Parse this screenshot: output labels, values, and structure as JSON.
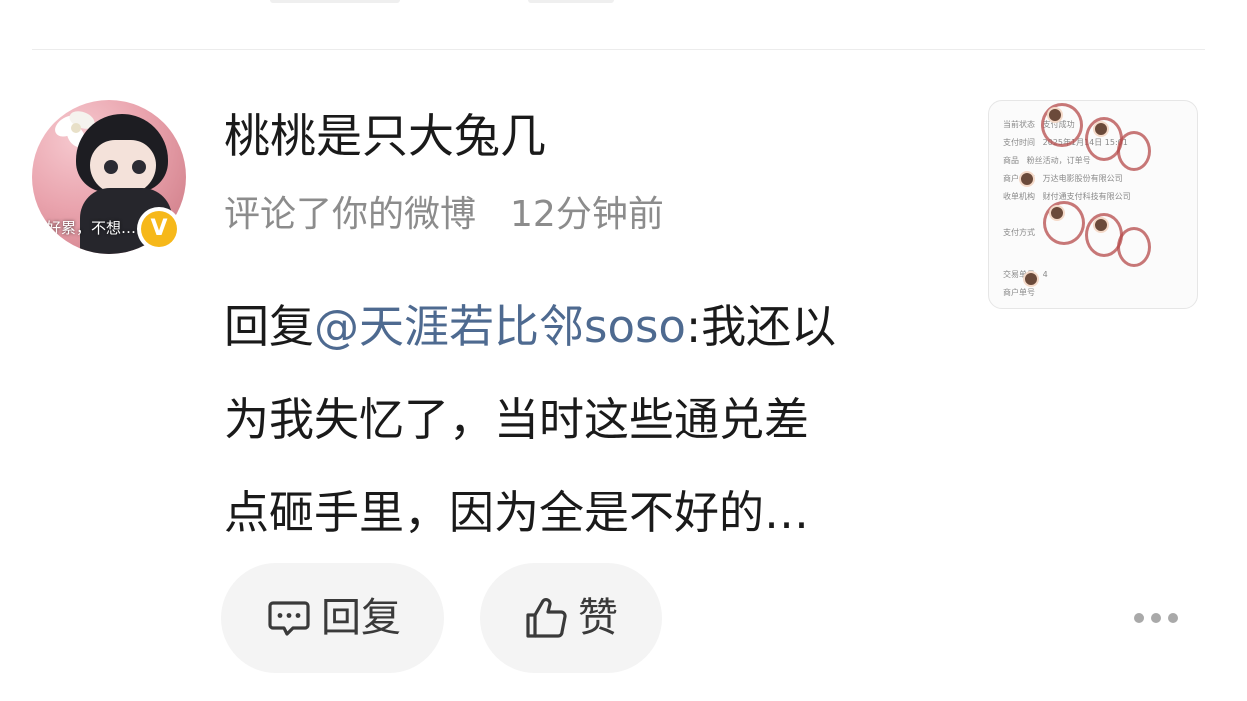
{
  "notification": {
    "username": "桃桃是只大兔几",
    "action": "评论了你的微博",
    "time": "12分钟前",
    "avatar_caption": "好累，不想…",
    "verified_badge": "V",
    "comment": {
      "prefix": "回复",
      "mention": "@天涯若比邻soso",
      "line1_rest": ":我还以",
      "line2": "为我失忆了，当时这些通兑差",
      "line3": "点砸手里，因为全是不好的…"
    },
    "thumbnail": {
      "rows": [
        {
          "label": "当前状态",
          "value": "支付成功"
        },
        {
          "label": "支付时间",
          "value": "2025年1月14日 15:01"
        },
        {
          "label": "商品",
          "value": "粉丝活动，订单号"
        },
        {
          "label": "商户全称",
          "value": "万达电影股份有限公司"
        },
        {
          "label": "收单机构",
          "value": "财付通支付科技有限公司"
        },
        {
          "label": "支付方式",
          "value": ""
        },
        {
          "label": "交易单号",
          "value": "4"
        },
        {
          "label": "商户单号",
          "value": ""
        }
      ]
    }
  },
  "actions": {
    "reply_label": "回复",
    "like_label": "赞"
  },
  "colors": {
    "mention": "#4e6a90",
    "meta": "#8c8c8c",
    "badge": "#f6b81a",
    "pill_bg": "#f4f4f4"
  }
}
